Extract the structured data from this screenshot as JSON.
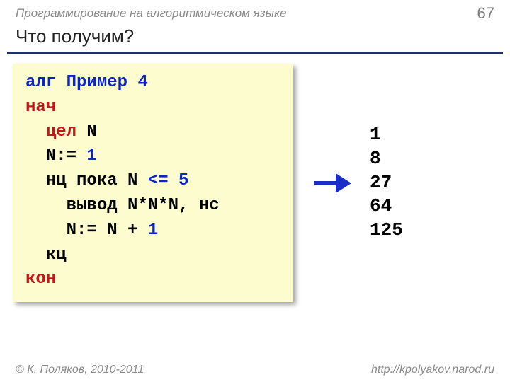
{
  "header": {
    "course": "Программирование на алгоритмическом языке",
    "page": "67"
  },
  "title": "Что получим?",
  "code": {
    "l1a": "алг",
    "l1b": " Пример 4",
    "l2": "нач",
    "l3a": "  ",
    "l3b": "цел",
    "l3c": " N",
    "l4a": "  N:= ",
    "l4b": "1",
    "l5a": "  нц пока N ",
    "l5b": "<=",
    "l5c": " ",
    "l5d": "5",
    "l6": "    вывод N*N*N, нс",
    "l7a": "    N:= N",
    "l7b": " + ",
    "l7c": "1",
    "l8": "  кц",
    "l9": "кон"
  },
  "output": "1\n8\n27\n64\n125",
  "footer": {
    "left": "© К. Поляков, 2010-2011",
    "right": "http://kpolyakov.narod.ru"
  }
}
